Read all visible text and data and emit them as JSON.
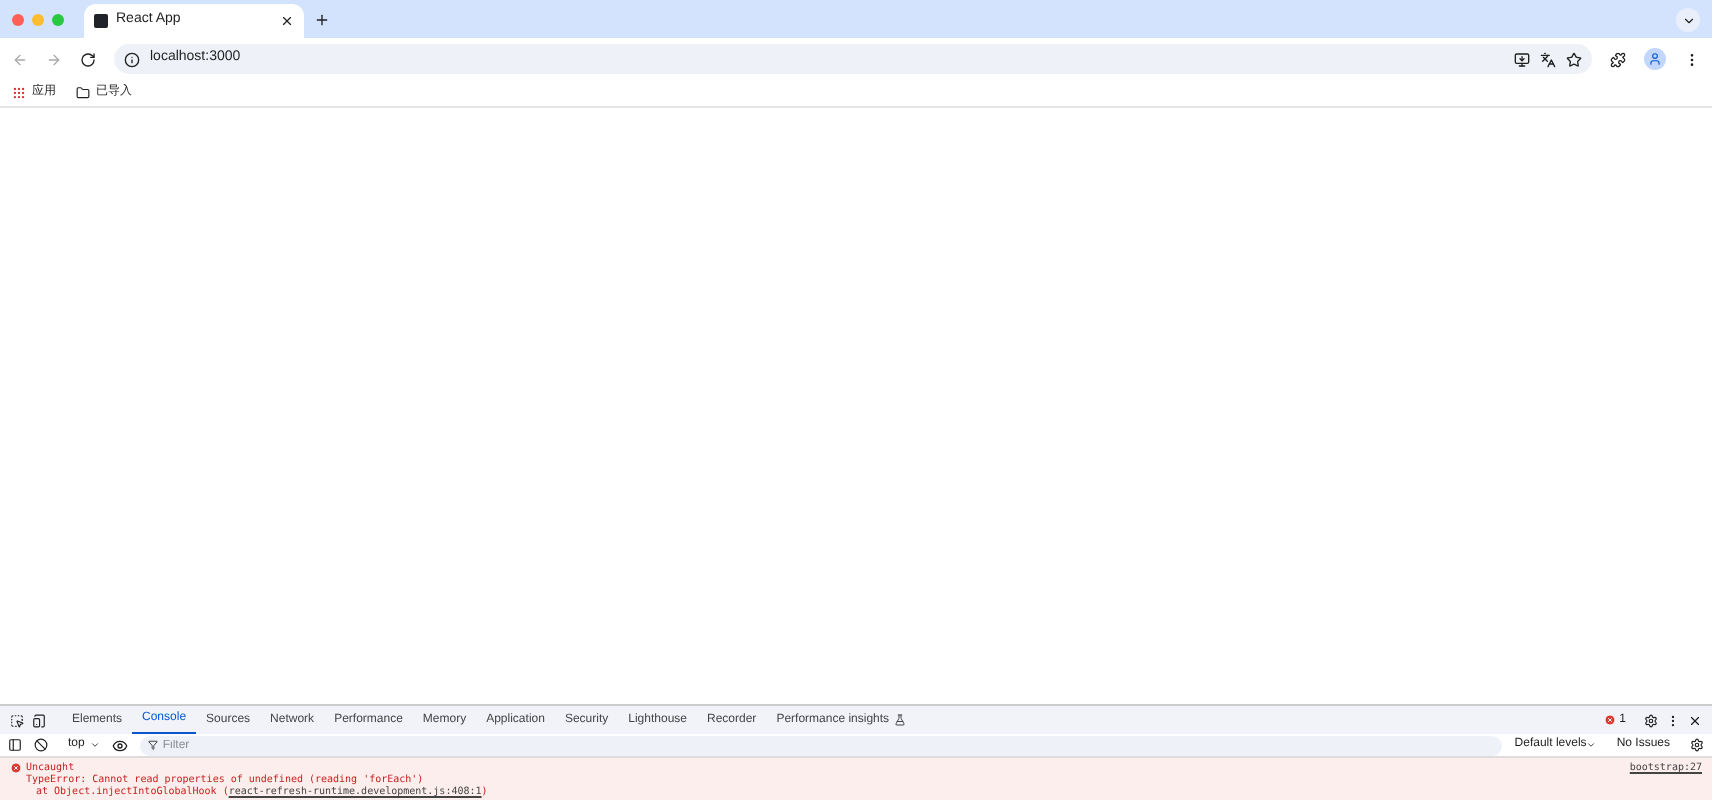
{
  "browser": {
    "tabs": [
      {
        "title": "React App",
        "selected": true
      }
    ],
    "address": "localhost:3000",
    "bookmarks": [
      {
        "kind": "apps",
        "label": "应用"
      },
      {
        "kind": "folder",
        "label": "已导入"
      }
    ]
  },
  "devtools": {
    "tabs": [
      {
        "label": "Elements",
        "selected": false
      },
      {
        "label": "Console",
        "selected": true
      },
      {
        "label": "Sources",
        "selected": false
      },
      {
        "label": "Network",
        "selected": false
      },
      {
        "label": "Performance",
        "selected": false
      },
      {
        "label": "Memory",
        "selected": false
      },
      {
        "label": "Application",
        "selected": false
      },
      {
        "label": "Security",
        "selected": false
      },
      {
        "label": "Lighthouse",
        "selected": false
      },
      {
        "label": "Recorder",
        "selected": false
      },
      {
        "label": "Performance insights",
        "selected": false
      }
    ],
    "error_count": "1",
    "context": "top",
    "filter_placeholder": "Filter",
    "levels": "Default levels",
    "issues": "No Issues",
    "messages": [
      {
        "title": "Uncaught",
        "source": "bootstrap:27",
        "lines": [
          "TypeError: Cannot read properties of undefined (reading 'forEach')"
        ],
        "stack": [
          {
            "prefix": "at Object.injectIntoGlobalHook (",
            "link": "react-refresh-runtime.development.js:408:1",
            "suffix": ")"
          }
        ]
      }
    ]
  }
}
